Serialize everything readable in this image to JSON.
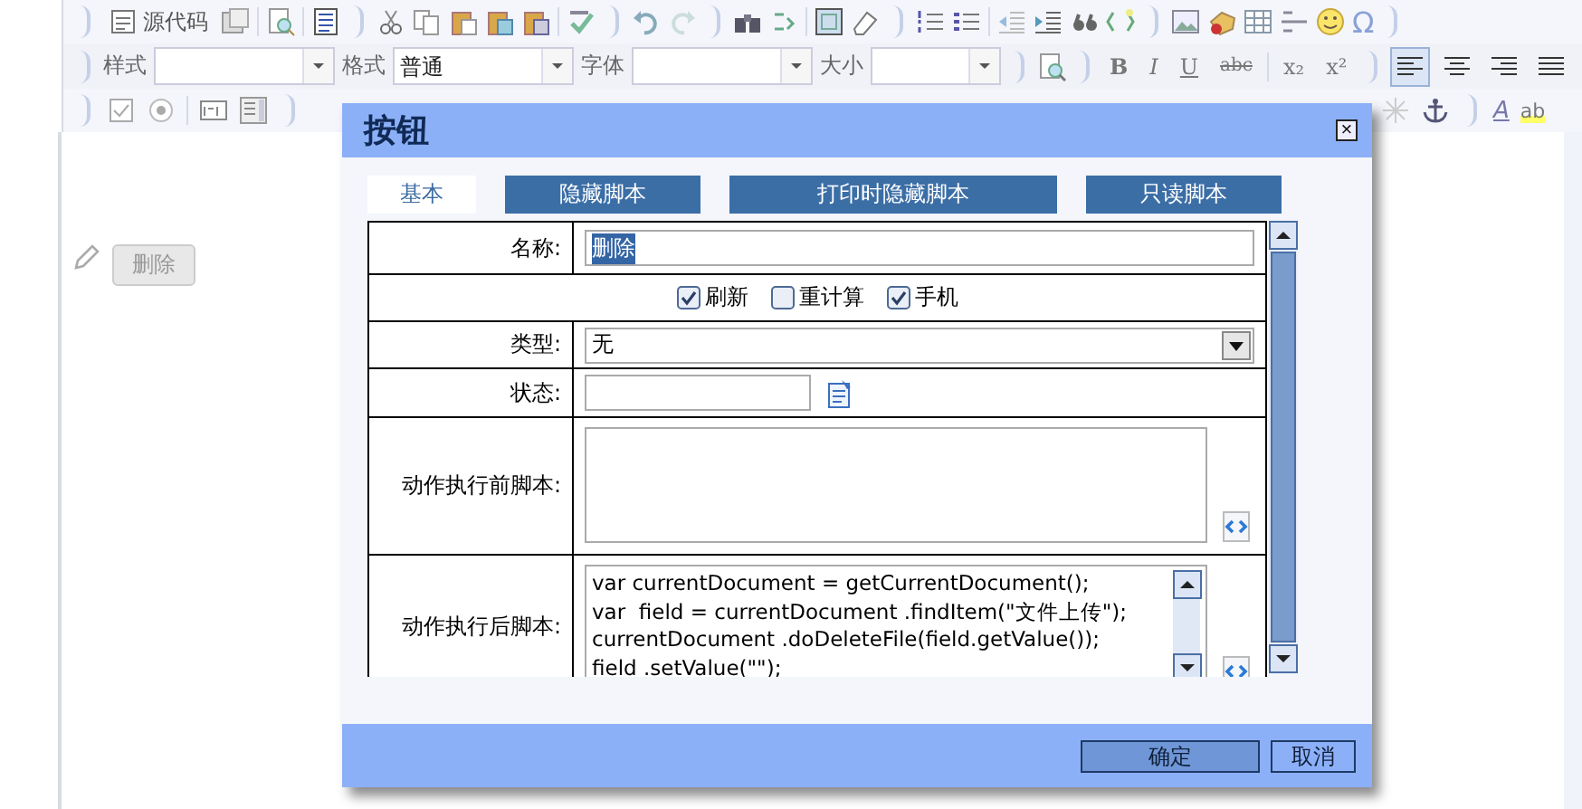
{
  "toolbar": {
    "source_label": "源代码",
    "style_label": "样式",
    "format_label": "格式",
    "format_value": "普通",
    "font_label": "字体",
    "size_label": "大小",
    "text_buttons": [
      {
        "glyph": "B",
        "kind": "bold"
      },
      {
        "glyph": "I",
        "kind": "italic"
      },
      {
        "glyph": "U",
        "kind": "underline"
      },
      {
        "glyph": "abc",
        "kind": "strike"
      }
    ],
    "script_buttons": [
      {
        "glyph": "x₂"
      },
      {
        "glyph": "x²"
      }
    ],
    "align": [
      {
        "selected": true
      },
      {
        "selected": false
      },
      {
        "selected": false
      },
      {
        "selected": false
      }
    ],
    "omega": "Ω",
    "font_color_glyph": "A",
    "bg_color_glyph": "ab"
  },
  "canvas": {
    "button": {
      "label": "删除",
      "disabled": true
    }
  },
  "dialog": {
    "title": "按钮",
    "close": "×",
    "tabs": [
      {
        "label": "基本",
        "selected": true
      },
      {
        "label": "隐藏脚本",
        "selected": false
      },
      {
        "label": "打印时隐藏脚本",
        "selected": false
      },
      {
        "label": "只读脚本",
        "selected": false
      }
    ],
    "fields": [
      {
        "kind": "text",
        "label": "名称:",
        "value": "删除",
        "value_selected": true
      },
      {
        "kind": "checks",
        "options": [
          {
            "label": "刷新",
            "checked": true
          },
          {
            "label": "重计算",
            "checked": false
          },
          {
            "label": "手机",
            "checked": true
          }
        ]
      },
      {
        "kind": "select",
        "label": "类型:",
        "value": "无"
      },
      {
        "kind": "state",
        "label": "状态:"
      },
      {
        "kind": "script",
        "label": "动作执行前脚本:"
      },
      {
        "kind": "script",
        "label": "动作执行后脚本:",
        "lines": [
          "var currentDocument = getCurrentDocument();",
          "var  field = currentDocument .findItem(\"文件上传\");",
          "currentDocument .doDeleteFile(field.getValue());",
          "field .setValue(\"\");"
        ]
      }
    ],
    "buttons": [
      "确定",
      "取消"
    ]
  }
}
